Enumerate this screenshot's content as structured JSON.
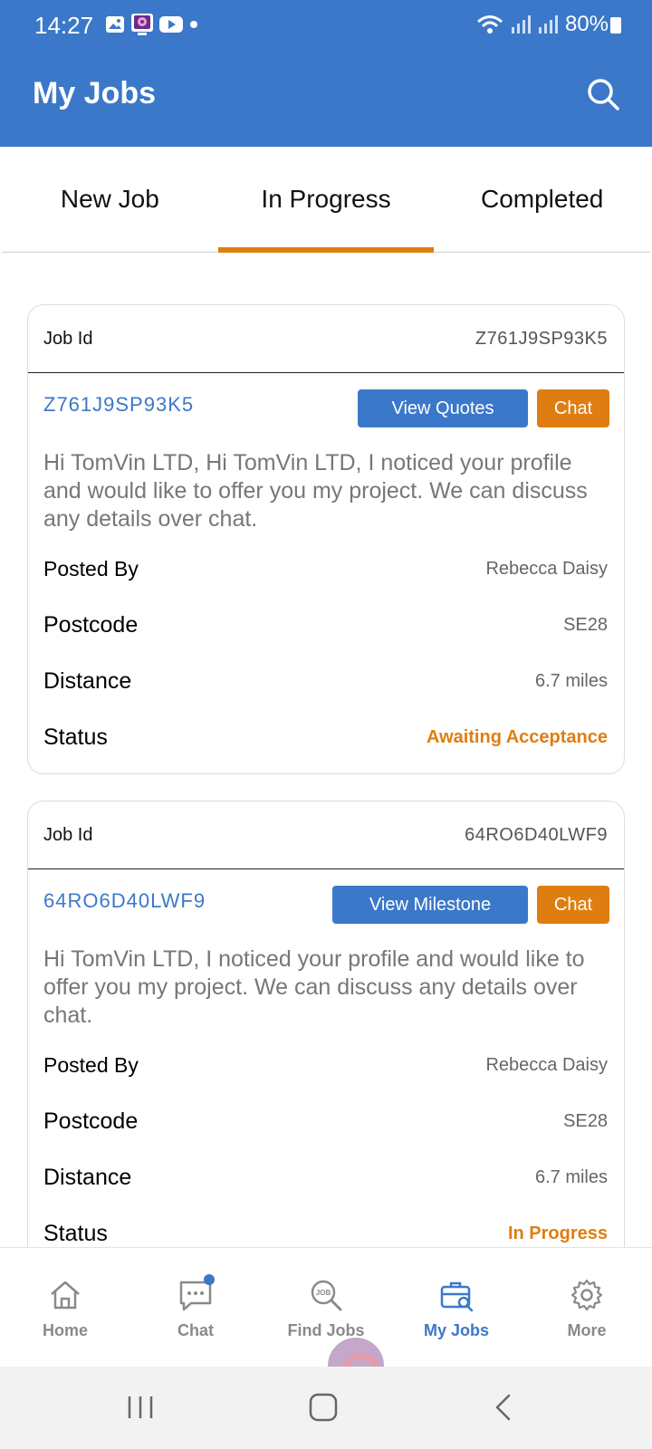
{
  "status_bar": {
    "time": "14:27",
    "battery": "80%"
  },
  "header": {
    "title": "My Jobs"
  },
  "tabs": [
    {
      "label": "New Job",
      "active": false
    },
    {
      "label": "In Progress",
      "active": true
    },
    {
      "label": "Completed",
      "active": false
    }
  ],
  "jobs": [
    {
      "id_label": "Job Id",
      "id": "Z761J9SP93K5",
      "action_label": "View Quotes",
      "chat_label": "Chat",
      "description": "Hi TomVin LTD, Hi TomVin LTD, I noticed your profile and would like to offer you my project. We can discuss any details over chat.",
      "posted_by_label": "Posted By",
      "posted_by": "Rebecca Daisy",
      "postcode_label": "Postcode",
      "postcode": "SE28",
      "distance_label": "Distance",
      "distance": "6.7 miles",
      "status_label": "Status",
      "status": "Awaiting Acceptance"
    },
    {
      "id_label": "Job Id",
      "id": "64RO6D40LWF9",
      "action_label": "View Milestone",
      "chat_label": "Chat",
      "description": "Hi TomVin LTD, I noticed your profile and would like to offer you my project. We can discuss any details over chat.",
      "posted_by_label": "Posted By",
      "posted_by": "Rebecca Daisy",
      "postcode_label": "Postcode",
      "postcode": "SE28",
      "distance_label": "Distance",
      "distance": "6.7 miles",
      "status_label": "Status",
      "status": "In Progress"
    }
  ],
  "bottom_nav": [
    {
      "label": "Home",
      "icon": "home-icon",
      "active": false
    },
    {
      "label": "Chat",
      "icon": "chat-icon",
      "active": false
    },
    {
      "label": "Find Jobs",
      "icon": "find-jobs-icon",
      "active": false
    },
    {
      "label": "My Jobs",
      "icon": "briefcase-icon",
      "active": true
    },
    {
      "label": "More",
      "icon": "gear-icon",
      "active": false
    }
  ],
  "colors": {
    "primary": "#3b78c9",
    "accent": "#e07d10"
  }
}
